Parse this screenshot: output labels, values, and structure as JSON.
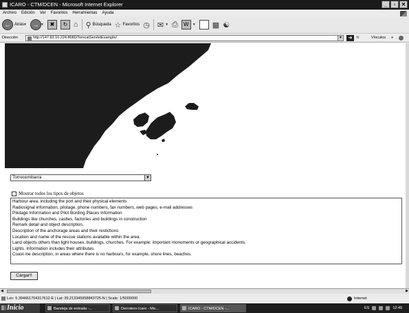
{
  "window": {
    "title": "ICARO - CTM/DCEN - Microsoft Internet Explorer",
    "buttons": [
      "_",
      "▫",
      "✕"
    ]
  },
  "menu": [
    "Archivo",
    "Edición",
    "Ver",
    "Favoritos",
    "Herramientas",
    "Ayuda"
  ],
  "toolbar": {
    "back_label": "Atrás",
    "search_label": "Búsqueda",
    "favorites_label": "Favoritos"
  },
  "address": {
    "label": "Dirección",
    "url": "http://147.83.10.224:8080/TomcatServletExample/",
    "go_label": "Ir",
    "links_label": "Vínculos"
  },
  "page": {
    "port_select": {
      "selected": "Torrecembarra"
    },
    "show_all_label": "Mostrar todos los tipos de objetos",
    "object_types": [
      "Harbour area, including the port and their physical elements",
      "Radiosignal information, pilotage, phone numbers, fax numbers, web pages, e-mail addresses",
      "Pilotage Information and Pilot Bording Places Information",
      "Buildings like churches, castles, factories and buildings in construction",
      "Remark detail and object description.",
      "Description of the anchorage areas and their restictions",
      "Location and name of the rescue stations available within the area.",
      "Land objects others than light houses, buildings, churches. For example: important monuments or geographical accidents.",
      "Lights. Information includes their attributes.",
      "Coast ine description, in areas where there is no harbours, for example, shore lines, beaches."
    ],
    "load_button": "Cargar!!"
  },
  "status": {
    "text": "Lon: 5.394661704317612-E | Lat: 39.213345958843725-N | Scale: 1/5000000",
    "zone": "Internet"
  },
  "taskbar": {
    "start_label": "Inicio",
    "tasks": [
      {
        "label": "Bandeja de entrada -...",
        "active": false
      },
      {
        "label": "Derrotero-Icaro - Mic...",
        "active": false
      },
      {
        "label": "ICARO - CTM/DCEN -...",
        "active": true
      }
    ],
    "lang": "ES",
    "clock": "12:49"
  },
  "icons": {
    "back": "back-arrow-icon",
    "forward": "forward-arrow-icon",
    "stop": "stop-icon",
    "refresh": "refresh-icon",
    "home": "home-icon",
    "search": "search-icon",
    "favorites": "favorites-star-icon",
    "history": "history-icon",
    "mail": "mail-icon",
    "print": "print-icon",
    "edit": "edit-icon",
    "discuss": "discuss-icon",
    "research": "research-icon",
    "messenger": "messenger-icon"
  },
  "colors": {
    "map_land": "#1c1c1c",
    "taskbar": "#1e1e1e"
  }
}
